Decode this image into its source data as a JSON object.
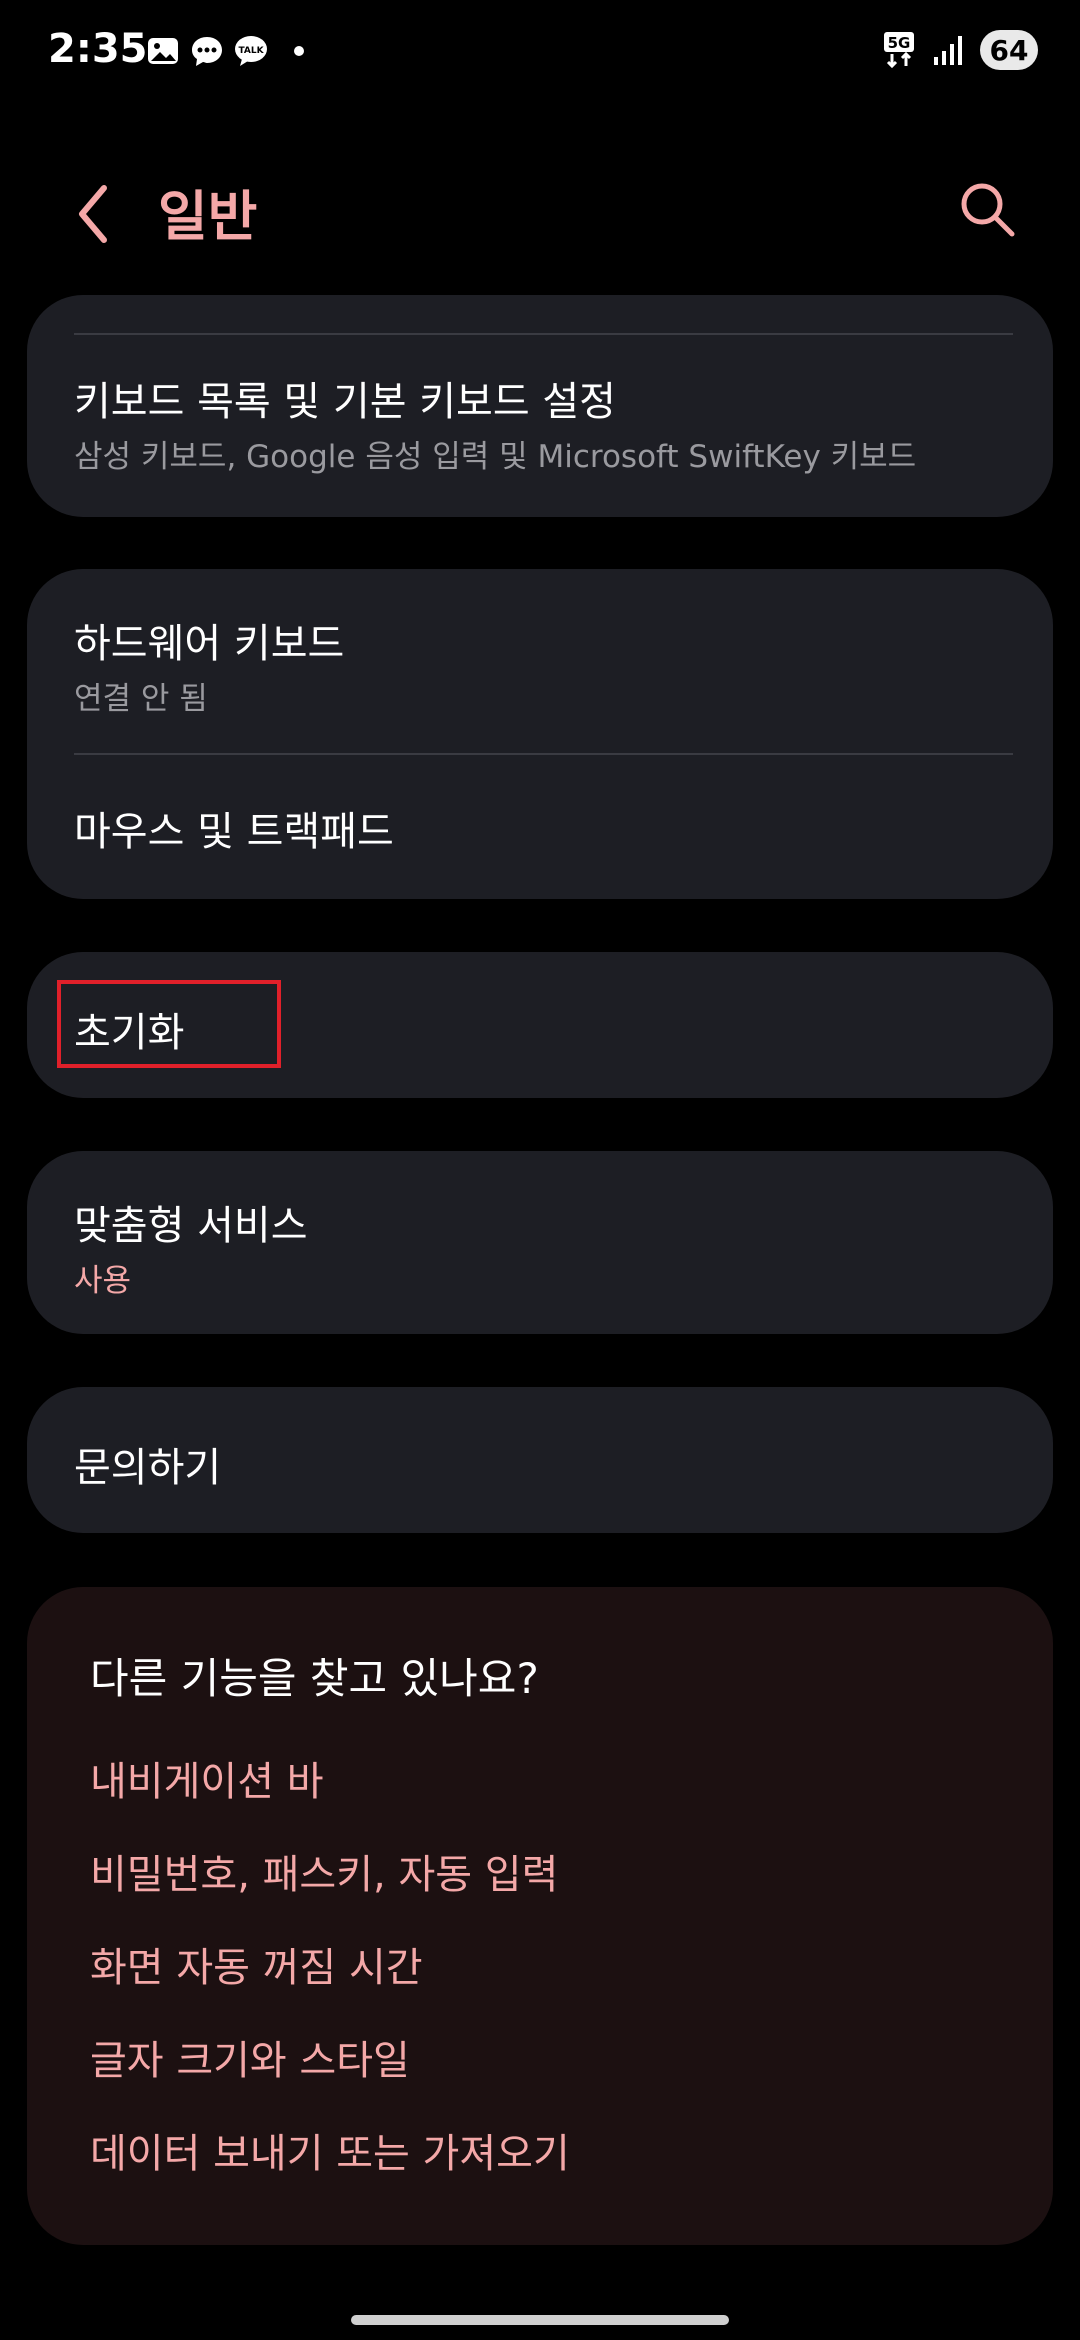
{
  "status_bar": {
    "time": "2:35",
    "network": "5G",
    "battery": "64",
    "icons": [
      "gallery-icon",
      "message-icon",
      "talk-icon",
      "notification-dot",
      "network-5g-icon",
      "signal-icon",
      "battery-icon"
    ]
  },
  "header": {
    "title": "일반",
    "back_icon": "chevron-left-icon",
    "search_icon": "search-icon"
  },
  "cards": {
    "keyboard": {
      "title": "키보드 목록 및 기본 키보드 설정",
      "subtitle": "삼성 키보드, Google 음성 입력 및 Microsoft SwiftKey 키보드"
    },
    "hardware": {
      "title": "하드웨어 키보드",
      "subtitle": "연결 안 됨"
    },
    "mouse": {
      "title": "마우스 및 트랙패드"
    },
    "reset": {
      "title": "초기화"
    },
    "custom": {
      "title": "맞춤형 서비스",
      "subtitle": "사용"
    },
    "contact": {
      "title": "문의하기"
    }
  },
  "suggestions": {
    "title": "다른 기능을 찾고 있나요?",
    "links": [
      "내비게이션 바",
      "비밀번호, 패스키, 자동 입력",
      "화면 자동 꺼짐 시간",
      "글자 크기와 스타일",
      "데이터 보내기 또는 가져오기"
    ]
  },
  "colors": {
    "accent": "#f4a8a8",
    "card_bg": "#1d1e24",
    "suggestion_bg": "#1c1011",
    "highlight": "#e0202a"
  }
}
